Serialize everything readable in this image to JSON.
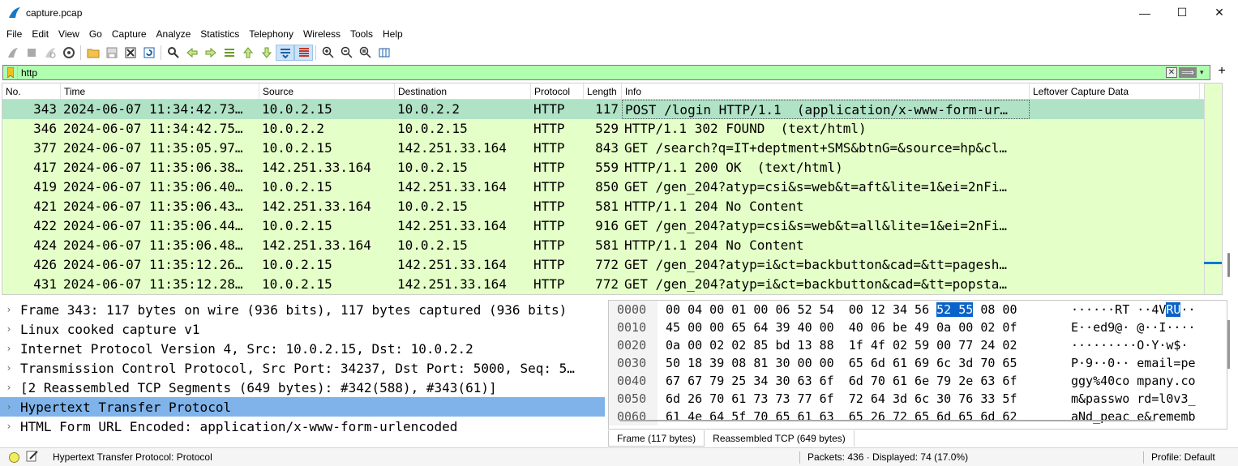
{
  "window": {
    "title": "capture.pcap",
    "minimize_glyph": "—",
    "maximize_glyph": "☐",
    "close_glyph": "✕"
  },
  "menu": [
    "File",
    "Edit",
    "View",
    "Go",
    "Capture",
    "Analyze",
    "Statistics",
    "Telephony",
    "Wireless",
    "Tools",
    "Help"
  ],
  "toolbar": {
    "icons": [
      "start-capture-icon",
      "stop-capture-icon",
      "restart-capture-icon",
      "capture-options-icon",
      "open-file-icon",
      "save-file-icon",
      "close-file-icon",
      "reload-file-icon",
      "find-packet-icon",
      "go-back-icon",
      "go-forward-icon",
      "go-to-packet-icon",
      "go-first-icon",
      "go-last-icon",
      "autoscroll-icon",
      "colorize-icon",
      "zoom-in-icon",
      "zoom-out-icon",
      "zoom-reset-icon",
      "resize-columns-icon"
    ]
  },
  "filter": {
    "value": "http",
    "clear_glyph": "✕",
    "apply_glyph": "⟹",
    "dropdown_glyph": "▾",
    "add_glyph": "+"
  },
  "packet_list": {
    "columns": [
      "No.",
      "Time",
      "Source",
      "Destination",
      "Protocol",
      "Length",
      "Info",
      "Leftover Capture Data"
    ],
    "selected_row": 0,
    "rows": [
      {
        "no": "343",
        "time": "2024-06-07 11:34:42.73…",
        "source": "10.0.2.15",
        "destination": "10.0.2.2",
        "protocol": "HTTP",
        "length": "117",
        "info": "POST /login HTTP/1.1  (application/x-www-form-ur…",
        "leftover": "",
        "rel": "→"
      },
      {
        "no": "346",
        "time": "2024-06-07 11:34:42.75…",
        "source": "10.0.2.2",
        "destination": "10.0.2.15",
        "protocol": "HTTP",
        "length": "529",
        "info": "HTTP/1.1 302 FOUND  (text/html)",
        "leftover": "",
        "rel": "←"
      },
      {
        "no": "377",
        "time": "2024-06-07 11:35:05.97…",
        "source": "10.0.2.15",
        "destination": "142.251.33.164",
        "protocol": "HTTP",
        "length": "843",
        "info": "GET /search?q=IT+deptment+SMS&btnG=&source=hp&cl…",
        "leftover": "",
        "rel": ""
      },
      {
        "no": "417",
        "time": "2024-06-07 11:35:06.38…",
        "source": "142.251.33.164",
        "destination": "10.0.2.15",
        "protocol": "HTTP",
        "length": "559",
        "info": "HTTP/1.1 200 OK  (text/html)",
        "leftover": "",
        "rel": ""
      },
      {
        "no": "419",
        "time": "2024-06-07 11:35:06.40…",
        "source": "10.0.2.15",
        "destination": "142.251.33.164",
        "protocol": "HTTP",
        "length": "850",
        "info": "GET /gen_204?atyp=csi&s=web&t=aft&lite=1&ei=2nFi…",
        "leftover": "",
        "rel": ""
      },
      {
        "no": "421",
        "time": "2024-06-07 11:35:06.43…",
        "source": "142.251.33.164",
        "destination": "10.0.2.15",
        "protocol": "HTTP",
        "length": "581",
        "info": "HTTP/1.1 204 No Content",
        "leftover": "",
        "rel": ""
      },
      {
        "no": "422",
        "time": "2024-06-07 11:35:06.44…",
        "source": "10.0.2.15",
        "destination": "142.251.33.164",
        "protocol": "HTTP",
        "length": "916",
        "info": "GET /gen_204?atyp=csi&s=web&t=all&lite=1&ei=2nFi…",
        "leftover": "",
        "rel": ""
      },
      {
        "no": "424",
        "time": "2024-06-07 11:35:06.48…",
        "source": "142.251.33.164",
        "destination": "10.0.2.15",
        "protocol": "HTTP",
        "length": "581",
        "info": "HTTP/1.1 204 No Content",
        "leftover": "",
        "rel": ""
      },
      {
        "no": "426",
        "time": "2024-06-07 11:35:12.26…",
        "source": "10.0.2.15",
        "destination": "142.251.33.164",
        "protocol": "HTTP",
        "length": "772",
        "info": "GET /gen_204?atyp=i&ct=backbutton&cad=&tt=pagesh…",
        "leftover": "",
        "rel": ""
      },
      {
        "no": "431",
        "time": "2024-06-07 11:35:12.28…",
        "source": "10.0.2.15",
        "destination": "142.251.33.164",
        "protocol": "HTTP",
        "length": "772",
        "info": "GET /gen_204?atyp=i&ct=backbutton&cad=&tt=popsta…",
        "leftover": "",
        "rel": ""
      }
    ]
  },
  "details": {
    "chevron": "›",
    "selected_row": 5,
    "rows": [
      "Frame 343: 117 bytes on wire (936 bits), 117 bytes captured (936 bits)",
      "Linux cooked capture v1",
      "Internet Protocol Version 4, Src: 10.0.2.15, Dst: 10.0.2.2",
      "Transmission Control Protocol, Src Port: 34237, Dst Port: 5000, Seq: 5…",
      "[2 Reassembled TCP Segments (649 bytes): #342(588), #343(61)]",
      "Hypertext Transfer Protocol",
      "HTML Form URL Encoded: application/x-www-form-urlencoded"
    ]
  },
  "bytes": {
    "rows": [
      {
        "offset": "0000",
        "hex_a": "00 04 00 01 00 06 52 54  00 12 34 56 ",
        "hex_hl": "52 55",
        "hex_b": " 08 00",
        "ascii_a": "······RT ··4V",
        "ascii_hl": "RU",
        "ascii_b": "··"
      },
      {
        "offset": "0010",
        "hex_a": "45 00 00 65 64 39 40 00  40 06 be 49 0a 00 02 0f",
        "hex_hl": "",
        "hex_b": "",
        "ascii_a": "E··ed9@· @··I····",
        "ascii_hl": "",
        "ascii_b": ""
      },
      {
        "offset": "0020",
        "hex_a": "0a 00 02 02 85 bd 13 88  1f 4f 02 59 00 77 24 02",
        "hex_hl": "",
        "hex_b": "",
        "ascii_a": "·········O·Y·w$·",
        "ascii_hl": "",
        "ascii_b": ""
      },
      {
        "offset": "0030",
        "hex_a": "50 18 39 08 81 30 00 00  65 6d 61 69 6c 3d 70 65",
        "hex_hl": "",
        "hex_b": "",
        "ascii_a": "P·9··0·· email=pe",
        "ascii_hl": "",
        "ascii_b": ""
      },
      {
        "offset": "0040",
        "hex_a": "67 67 79 25 34 30 63 6f  6d 70 61 6e 79 2e 63 6f",
        "hex_hl": "",
        "hex_b": "",
        "ascii_a": "ggy%40co mpany.co",
        "ascii_hl": "",
        "ascii_b": ""
      },
      {
        "offset": "0050",
        "hex_a": "6d 26 70 61 73 73 77 6f  72 64 3d 6c 30 76 33 5f",
        "hex_hl": "",
        "hex_b": "",
        "ascii_a": "m&passwo rd=l0v3_",
        "ascii_hl": "",
        "ascii_b": ""
      },
      {
        "offset": "0060",
        "hex_a": "61 4e 64 5f 70 65 61 63  65 26 72 65 6d 65 6d 62",
        "hex_hl": "",
        "hex_b": "",
        "ascii_a": "aNd_peac e&rememb",
        "ascii_hl": "",
        "ascii_b": ""
      }
    ]
  },
  "tabs": [
    "Frame (117 bytes)",
    "Reassembled TCP (649 bytes)"
  ],
  "status": {
    "text": "Hypertext Transfer Protocol: Protocol",
    "packets": "Packets: 436 · Displayed: 74 (17.0%)",
    "profile": "Profile: Default"
  },
  "colors": {
    "filter_valid": "#afffaf",
    "http_row": "#e4ffc7",
    "selected_row": "#b0e2c6",
    "detail_selected": "#7fb3ea",
    "byte_highlight": "#0a63c9"
  }
}
